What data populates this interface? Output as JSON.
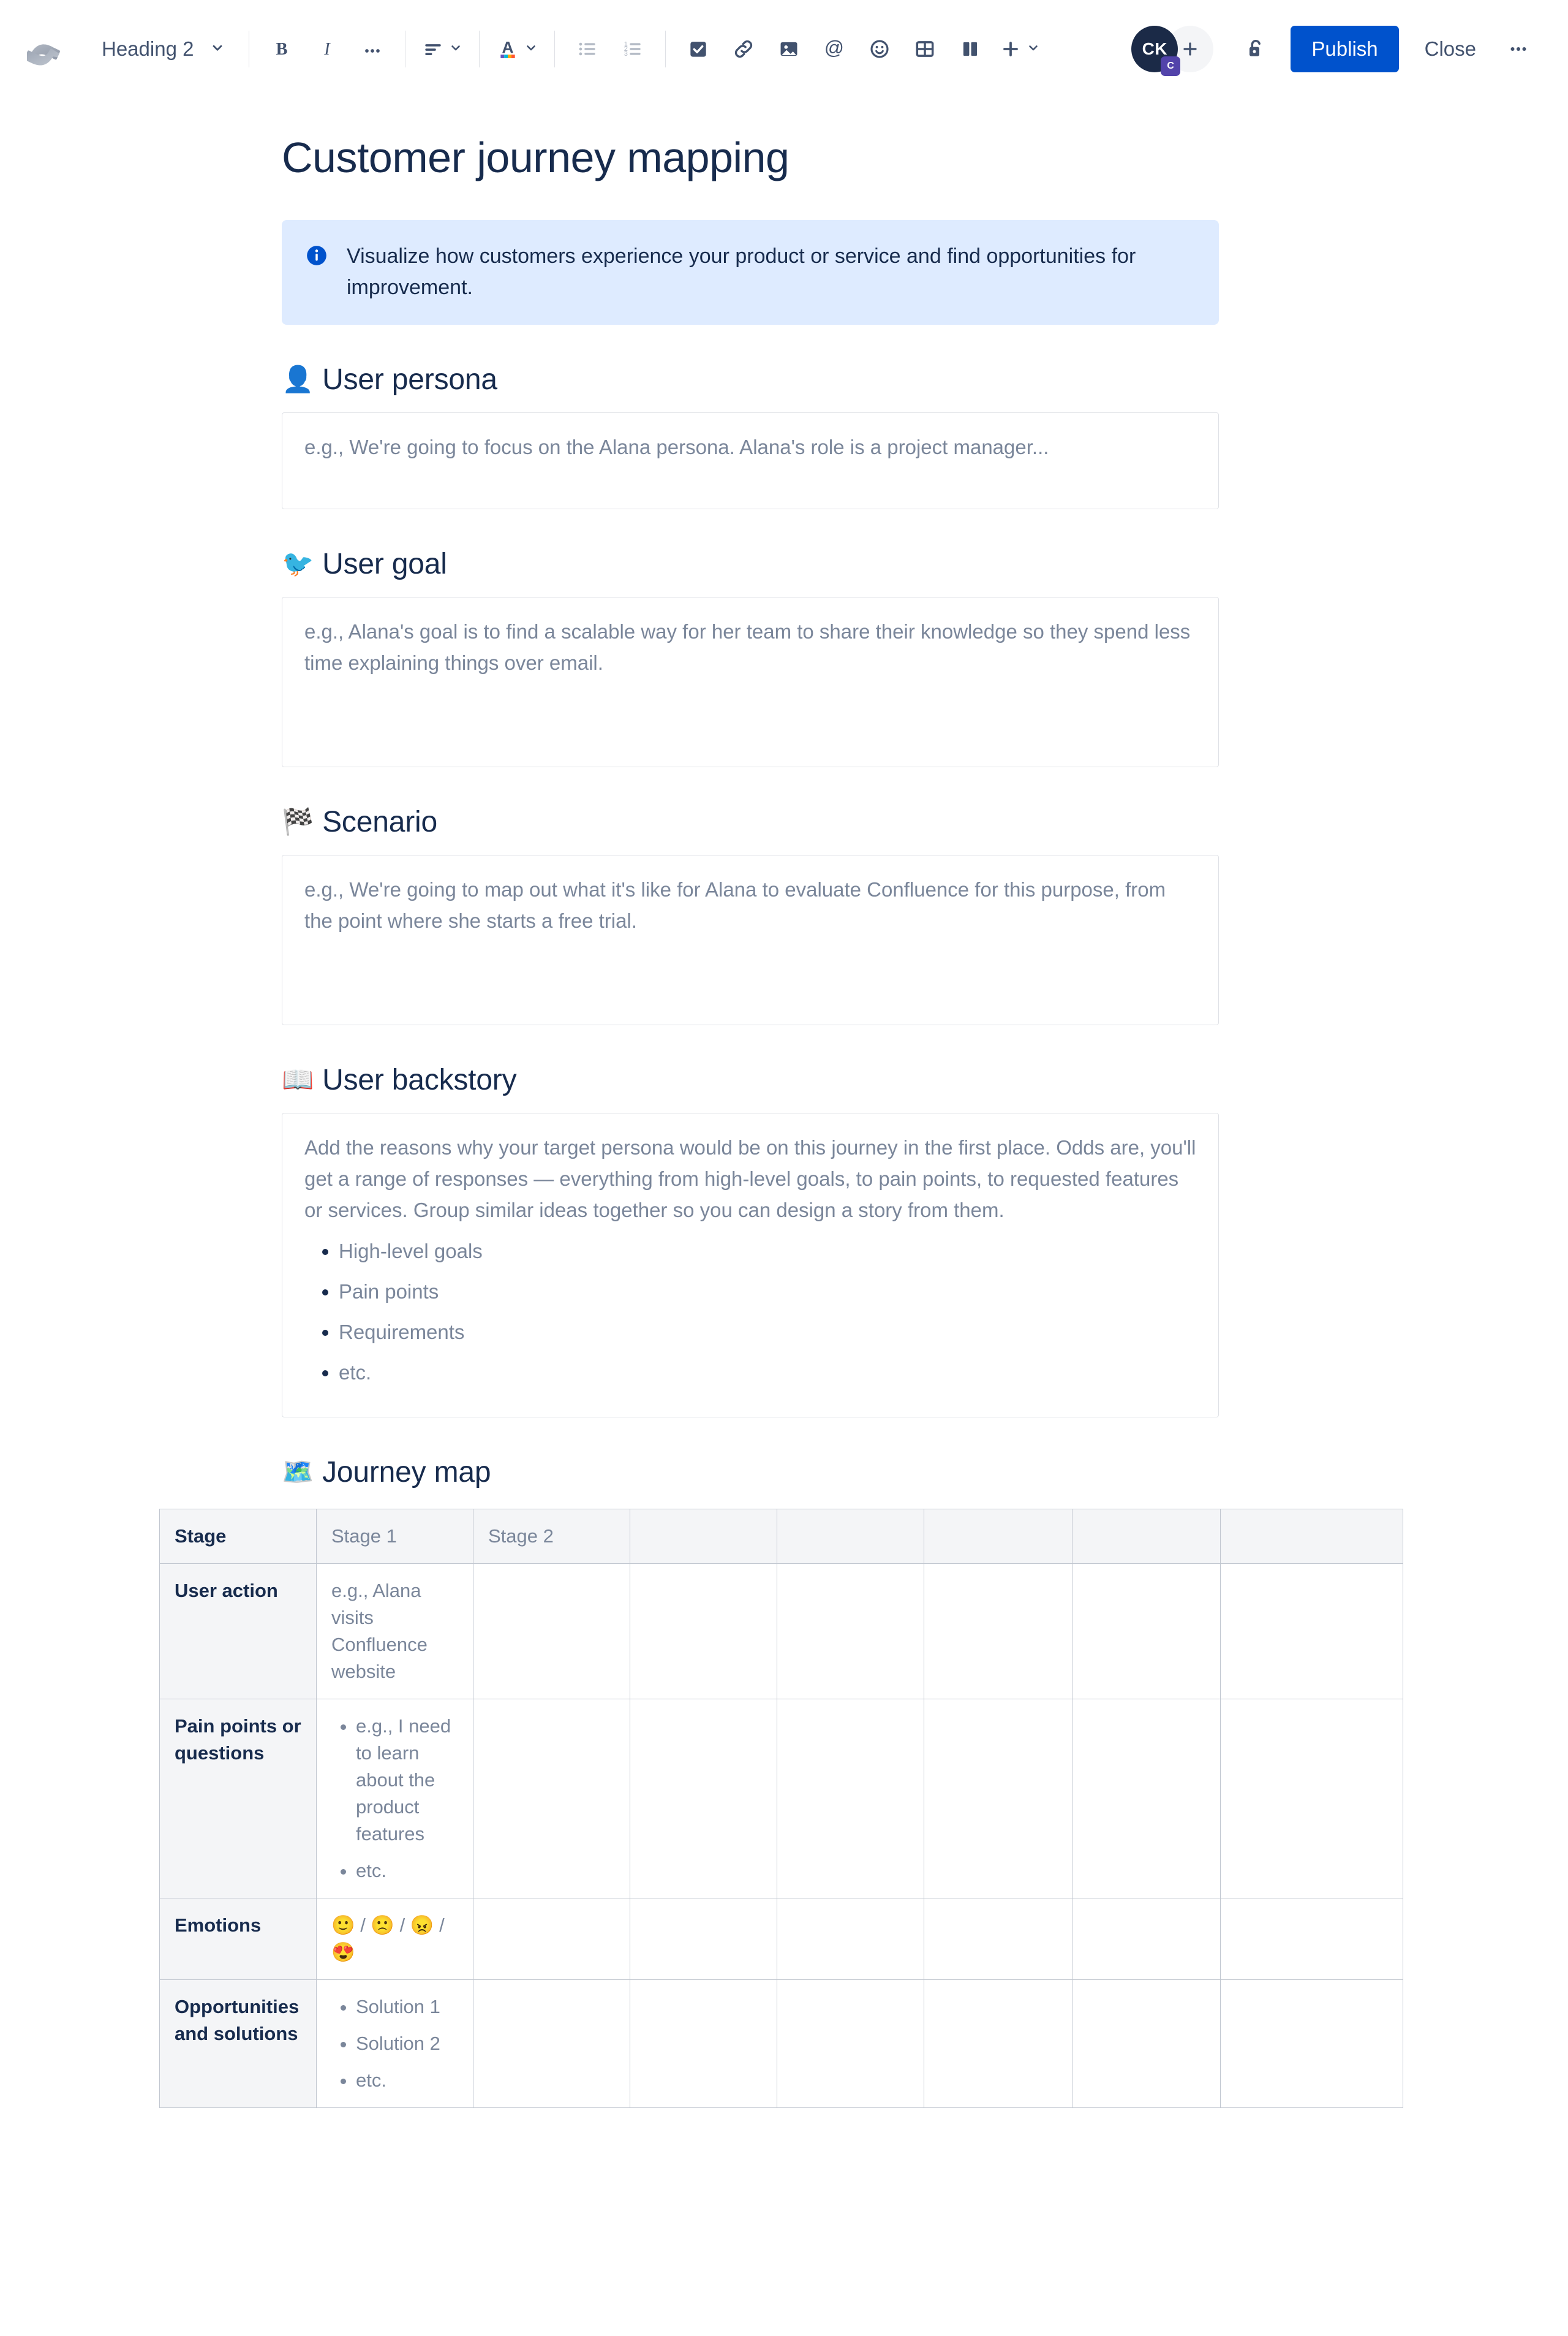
{
  "toolbar": {
    "logo_name": "confluence-logo",
    "block_type": {
      "label": "Heading 2",
      "caret": "chevron-down-icon"
    },
    "buttons": [
      {
        "name": "bold",
        "label": "B"
      },
      {
        "name": "italic",
        "label": "I"
      },
      {
        "name": "more-formatting",
        "label": "•••"
      }
    ],
    "align_label": "align-icon",
    "text_color_label": "A",
    "list_bullet": "bullet-list-icon",
    "list_numbered": "numbered-list-icon",
    "action_item": "task-checkbox-icon",
    "link": "link-icon",
    "image": "image-icon",
    "mention": "@",
    "emoji": "emoji-icon",
    "table": "table-icon",
    "layout": "layout-icon",
    "insert": "plus-icon",
    "avatar": {
      "initials": "CK",
      "badge": "C"
    },
    "add_people": "plus-icon",
    "restrictions": "unlock-icon",
    "publish_label": "Publish",
    "close_label": "Close",
    "more_label": "•••"
  },
  "document": {
    "title": "Customer journey mapping",
    "info_panel": {
      "icon": "info-icon",
      "text": "Visualize how customers experience your product or service and find opportunities for improvement."
    },
    "sections": [
      {
        "emoji": "👤",
        "emoji_name": "bust-in-silhouette-emoji",
        "heading": "User persona",
        "placeholder": "e.g., We're going to focus on the Alana persona. Alana's role is a project manager..."
      },
      {
        "emoji": "🐦",
        "emoji_name": "bird-emoji",
        "heading": "User goal",
        "placeholder": "e.g., Alana's goal is to find a scalable way for her team to share their knowledge so they spend less time explaining things over email."
      },
      {
        "emoji": "🏁",
        "emoji_name": "chequered-flag-emoji",
        "heading": "Scenario",
        "placeholder": "e.g., We're going to map out what it's like for Alana to evaluate Confluence for this purpose, from the point where she starts a free trial."
      },
      {
        "emoji": "📖",
        "emoji_name": "open-book-emoji",
        "heading": "User backstory",
        "placeholder": "Add the reasons why your target persona would be on this journey in the first place. Odds are, you'll get a range of responses — everything from high-level goals, to pain points, to requested features or services. Group similar ideas together so you can design a story from them.",
        "bullets": [
          "High-level goals",
          "Pain points",
          "Requirements",
          "etc."
        ]
      },
      {
        "emoji": "🗺️",
        "emoji_name": "world-map-emoji",
        "heading": "Journey map"
      }
    ],
    "journey_table": {
      "headers": [
        "Stage",
        "Stage 1",
        "Stage 2",
        "",
        "",
        "",
        "",
        ""
      ],
      "rows": [
        {
          "label": "User action",
          "cells": [
            {
              "type": "text",
              "value": "e.g., Alana visits Confluence website"
            },
            {
              "type": "text",
              "value": ""
            },
            {
              "type": "text",
              "value": ""
            },
            {
              "type": "text",
              "value": ""
            },
            {
              "type": "text",
              "value": ""
            },
            {
              "type": "text",
              "value": ""
            },
            {
              "type": "text",
              "value": ""
            }
          ]
        },
        {
          "label": "Pain points or questions",
          "cells": [
            {
              "type": "list",
              "items": [
                "e.g., I need to learn about the product features",
                "etc."
              ]
            },
            {
              "type": "text",
              "value": ""
            },
            {
              "type": "text",
              "value": ""
            },
            {
              "type": "text",
              "value": ""
            },
            {
              "type": "text",
              "value": ""
            },
            {
              "type": "text",
              "value": ""
            },
            {
              "type": "text",
              "value": ""
            }
          ]
        },
        {
          "label": "Emotions",
          "cells": [
            {
              "type": "text",
              "value": "🙂 / 🙁 / 😠 / 😍"
            },
            {
              "type": "text",
              "value": ""
            },
            {
              "type": "text",
              "value": ""
            },
            {
              "type": "text",
              "value": ""
            },
            {
              "type": "text",
              "value": ""
            },
            {
              "type": "text",
              "value": ""
            },
            {
              "type": "text",
              "value": ""
            }
          ]
        },
        {
          "label": "Opportunities and solutions",
          "cells": [
            {
              "type": "list",
              "items": [
                "Solution 1",
                "Solution 2",
                "etc."
              ]
            },
            {
              "type": "text",
              "value": ""
            },
            {
              "type": "text",
              "value": ""
            },
            {
              "type": "text",
              "value": ""
            },
            {
              "type": "text",
              "value": ""
            },
            {
              "type": "text",
              "value": ""
            },
            {
              "type": "text",
              "value": ""
            }
          ]
        }
      ]
    }
  },
  "colors": {
    "brand_blue": "#0052CC",
    "info_panel_bg": "#DEEBFF",
    "text_primary": "#172B4D",
    "text_subtle": "#7A869A",
    "border": "#DFE1E6",
    "table_header_bg": "#F4F5F7",
    "table_border": "#C1C7D0",
    "avatar_bg": "#1B2A47",
    "avatar_badge_bg": "#5243AA"
  }
}
